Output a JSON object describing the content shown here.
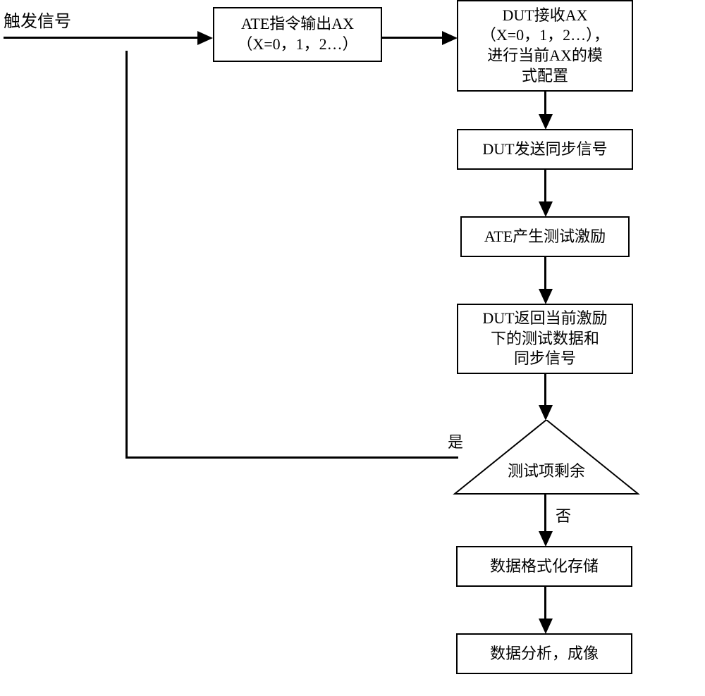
{
  "trigger_label": "触发信号",
  "box_ate_output": "ATE指令输出AX\n（X=0，1，2…）",
  "box_dut_receive": "DUT接收AX\n（X=0，1，2…），\n进行当前AX的模\n式配置",
  "box_dut_sync": "DUT发送同步信号",
  "box_ate_stimulus": "ATE产生测试激励",
  "box_dut_return": "DUT返回当前激励\n下的测试数据和\n同步信号",
  "decision_text": "测试项剩余",
  "label_yes": "是",
  "label_no": "否",
  "box_format_storage": "数据格式化存储",
  "box_data_analysis": "数据分析，成像"
}
